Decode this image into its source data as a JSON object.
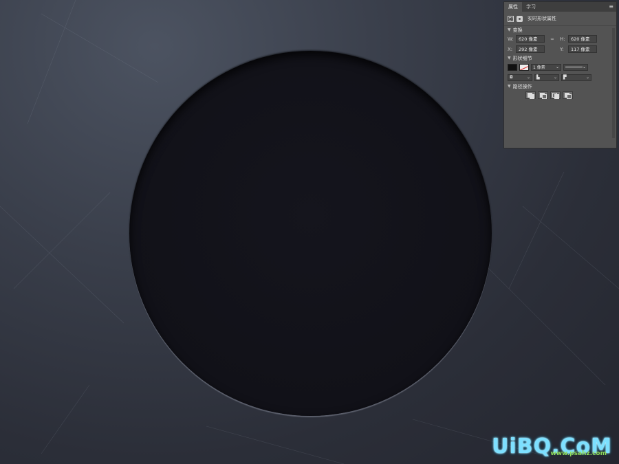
{
  "panel": {
    "tabs": [
      {
        "label": "属性"
      },
      {
        "label": "学习"
      }
    ],
    "type_label": "实时形状属性",
    "sections": {
      "transform": "变换",
      "appearance": "形状细节",
      "pathops": "路径操作"
    },
    "fields": {
      "w_label": "W:",
      "w_value": "620 像素",
      "h_label": "H:",
      "h_value": "620 像素",
      "x_label": "X:",
      "x_value": "292 像素",
      "y_label": "Y:",
      "y_value": "117 像素"
    },
    "stroke_width": "1 像素"
  },
  "watermark": {
    "main": "UiBQ.CoM",
    "sub": "www.psahz.com"
  }
}
